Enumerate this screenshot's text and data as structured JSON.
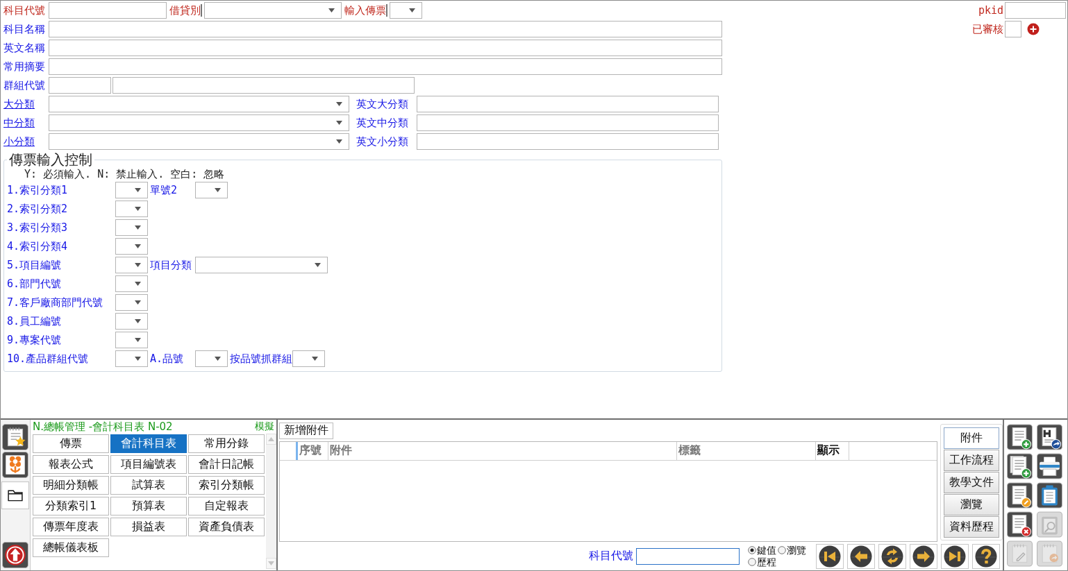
{
  "account_form": {
    "code": {
      "label": "科目代號",
      "required": true
    },
    "debit_credit": {
      "label": "借貸別",
      "required": true
    },
    "voucher_input": {
      "label": "輸入傳票",
      "required": true
    },
    "pkid": {
      "label": "pkid",
      "required": true
    },
    "approved": {
      "label": "已審核",
      "required": true
    },
    "name": {
      "label": "科目名稱",
      "required": false
    },
    "english_name": {
      "label": "英文名稱",
      "required": false
    },
    "common_summary": {
      "label": "常用摘要",
      "required": false
    },
    "group_code": {
      "label": "群組代號",
      "required": false
    },
    "classes": [
      {
        "label": "大分類",
        "link": true,
        "english_label": "英文大分類"
      },
      {
        "label": "中分類",
        "link": true,
        "english_label": "英文中分類"
      },
      {
        "label": "小分類",
        "link": true,
        "english_label": "英文小分類"
      }
    ]
  },
  "voucher_input_control": {
    "legend": "傳票輸入控制",
    "note": "Y: 必須輸入. N: 禁止輸入. 空白: 忽略",
    "rows": [
      {
        "label": "1.索引分類1",
        "extras": [
          {
            "label": "單號2",
            "kind": "short"
          }
        ]
      },
      {
        "label": "2.索引分類2"
      },
      {
        "label": "3.索引分類3"
      },
      {
        "label": "4.索引分類4"
      },
      {
        "label": "5.項目編號",
        "extras": [
          {
            "label": "項目分類",
            "kind": "wide"
          }
        ]
      },
      {
        "label": "6.部門代號"
      },
      {
        "label": "7.客戶廠商部門代號"
      },
      {
        "label": "8.員工編號"
      },
      {
        "label": "9.專案代號"
      },
      {
        "label": "10.產品群組代號",
        "extras": [
          {
            "label": "A.品號",
            "kind": "short"
          },
          {
            "label": "按品號抓群組",
            "kind": "short"
          }
        ]
      }
    ]
  },
  "side_tabs": [
    {
      "kind": "notes",
      "selected": false
    },
    {
      "kind": "flower",
      "selected": false
    },
    {
      "kind": "folder",
      "selected": true
    }
  ],
  "module_panel": {
    "title": "N.總帳管理 -會計科目表 N-02",
    "mode": "模擬",
    "items": [
      {
        "label": "傳票",
        "selected": false
      },
      {
        "label": "會計科目表",
        "selected": true
      },
      {
        "label": "常用分錄",
        "selected": false
      },
      {
        "label": "報表公式",
        "selected": false
      },
      {
        "label": "項目編號表",
        "selected": false
      },
      {
        "label": "會計日記帳",
        "selected": false
      },
      {
        "label": "明細分類帳",
        "selected": false
      },
      {
        "label": "試算表",
        "selected": false
      },
      {
        "label": "索引分類帳",
        "selected": false
      },
      {
        "label": "分類索引1",
        "selected": false
      },
      {
        "label": "預算表",
        "selected": false
      },
      {
        "label": "自定報表",
        "selected": false
      },
      {
        "label": "傳票年度表",
        "selected": false
      },
      {
        "label": "損益表",
        "selected": false
      },
      {
        "label": "資產負債表",
        "selected": false
      },
      {
        "label": "總帳儀表板",
        "selected": false
      }
    ]
  },
  "attachments": {
    "add_button": "新增附件",
    "columns": [
      {
        "label": "序號",
        "highlighted": false
      },
      {
        "label": "附件",
        "highlighted": false
      },
      {
        "label": "標籤",
        "highlighted": false
      },
      {
        "label": "顯示",
        "highlighted": true
      }
    ]
  },
  "detail_tabs": [
    {
      "label": "附件",
      "selected": true
    },
    {
      "label": "工作流程",
      "selected": false
    },
    {
      "label": "教學文件",
      "selected": false
    },
    {
      "label": "瀏覽",
      "selected": false
    },
    {
      "label": "資料歷程",
      "selected": false
    }
  ],
  "search": {
    "label": "科目代號",
    "modes": [
      {
        "label": "鍵值",
        "selected": true
      },
      {
        "label": "瀏覽",
        "selected": false
      },
      {
        "label": "歷程",
        "selected": false
      }
    ]
  },
  "toolbar": [
    {
      "kind": "add",
      "disabled": false
    },
    {
      "kind": "export",
      "disabled": false
    },
    {
      "kind": "copy",
      "disabled": false
    },
    {
      "kind": "print",
      "disabled": false
    },
    {
      "kind": "modify",
      "disabled": false
    },
    {
      "kind": "paste",
      "disabled": false
    },
    {
      "kind": "delete",
      "disabled": false
    },
    {
      "kind": "find",
      "disabled": true
    },
    {
      "kind": "edit",
      "disabled": true
    },
    {
      "kind": "forward",
      "disabled": true
    }
  ]
}
